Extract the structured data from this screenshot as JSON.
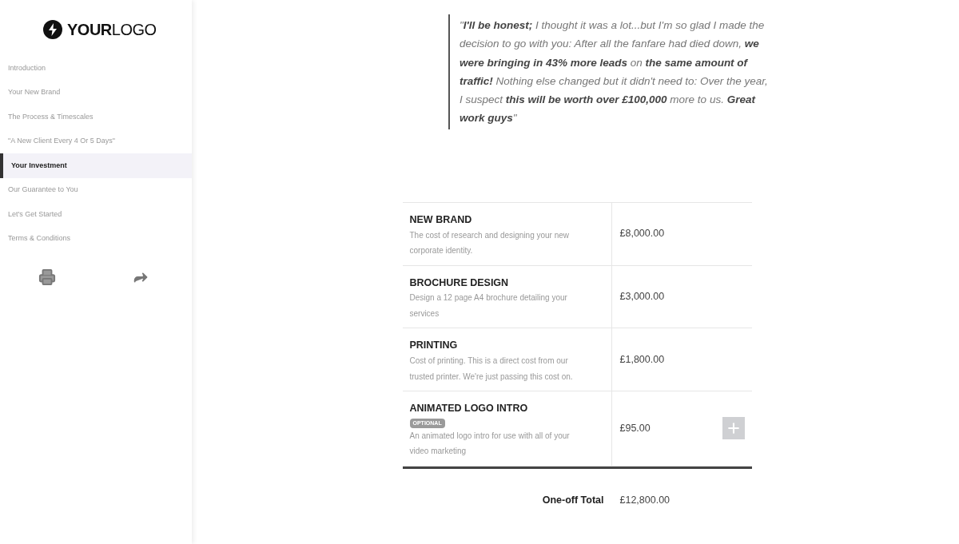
{
  "logo": "**YOUR**LOGO",
  "nav": [
    {
      "label": "Introduction",
      "selected": false
    },
    {
      "label": "Your New Brand",
      "selected": false
    },
    {
      "label": "The Process & Timescales",
      "selected": false
    },
    {
      "label": "\"A New Client Every 4 Or 5 Days\"",
      "selected": false
    },
    {
      "label": "Your Investment",
      "selected": true
    },
    {
      "label": "Our Guarantee to You",
      "selected": false
    },
    {
      "label": "Let's Get Started",
      "selected": false
    },
    {
      "label": "Terms & Conditions",
      "selected": false
    }
  ],
  "quote": "\"**I'll be honest;** I thought it was a lot...but I'm so glad I made the decision to go with you: After all the fanfare had died down, **we were bringing in 43% more leads** on **the same amount of traffic!** Nothing else changed but it didn't need to: Over the year, I suspect **this will be worth over £100,000** more to us. **Great work guys**\"",
  "items": [
    {
      "title": "NEW BRAND",
      "description": "The cost of research and designing your new corporate identity.",
      "price": "£8,000.00"
    },
    {
      "title": "BROCHURE DESIGN",
      "description": "Design a 12 page A4 brochure detailing your services",
      "price": "£3,000.00"
    },
    {
      "title": "PRINTING",
      "description": "Cost of printing. This is a direct cost from our trusted printer. We're just passing this cost on.",
      "price": "£1,800.00"
    },
    {
      "title": "ANIMATED LOGO INTRO",
      "badge": "OPTIONAL",
      "description": "An animated logo intro for use with all of your video marketing",
      "price": "£95.00",
      "addable": true
    }
  ],
  "total": {
    "label": "One-off Total",
    "value": "£12,800.00"
  }
}
